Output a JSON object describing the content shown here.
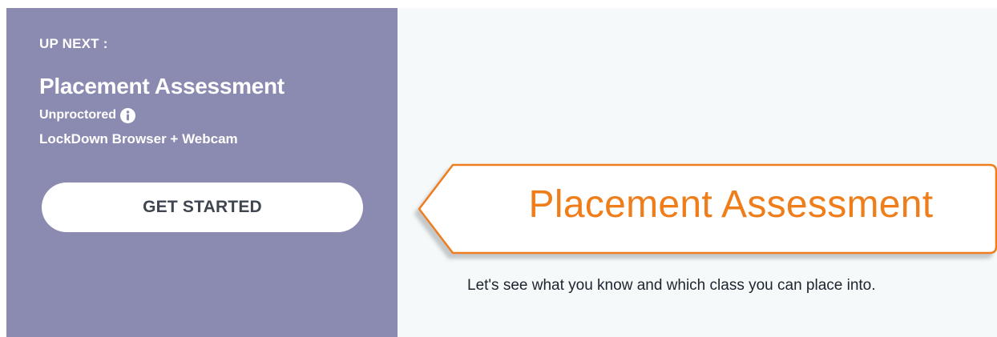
{
  "left_panel": {
    "up_next_label": "UP NEXT :",
    "title": "Placement Assessment",
    "proctoring": "Unproctored",
    "info_icon": "info-icon",
    "browser_requirement": "LockDown Browser + Webcam",
    "button_label": "GET STARTED",
    "background_color": "#8b8ab0"
  },
  "banner": {
    "title": "Placement Assessment",
    "accent_color": "#ef7d1a"
  },
  "description": "Let's see what you know and which class you can place into."
}
